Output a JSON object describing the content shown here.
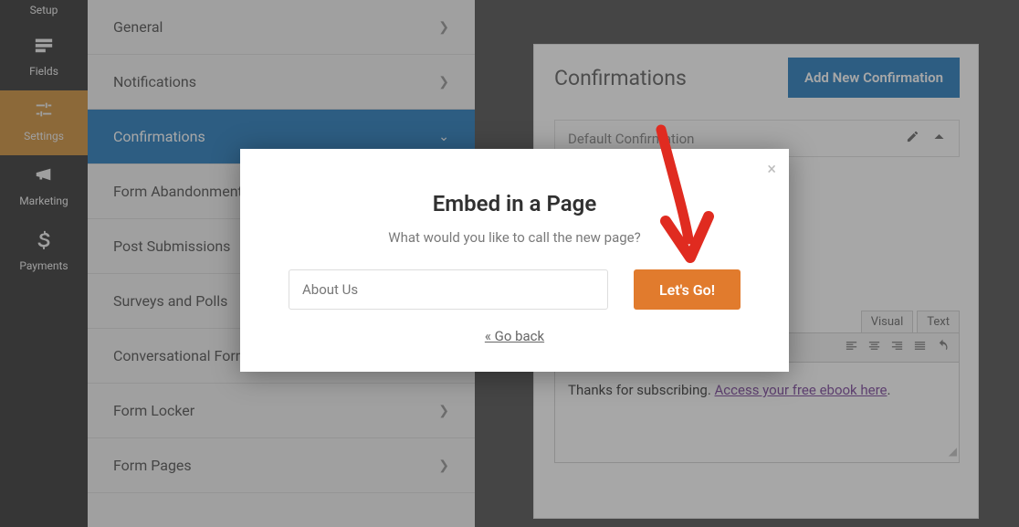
{
  "sidebar": {
    "items": [
      {
        "label": "Setup"
      },
      {
        "label": "Fields"
      },
      {
        "label": "Settings"
      },
      {
        "label": "Marketing"
      },
      {
        "label": "Payments"
      }
    ]
  },
  "settings_panel": {
    "items": [
      {
        "label": "General"
      },
      {
        "label": "Notifications"
      },
      {
        "label": "Confirmations"
      },
      {
        "label": "Form Abandonment"
      },
      {
        "label": "Post Submissions"
      },
      {
        "label": "Surveys and Polls"
      },
      {
        "label": "Conversational Forms"
      },
      {
        "label": "Form Locker"
      },
      {
        "label": "Form Pages"
      }
    ]
  },
  "main": {
    "title": "Confirmations",
    "add_btn": "Add New Confirmation",
    "default_row": "Default Confirmation",
    "editor": {
      "tab_visual": "Visual",
      "tab_text": "Text",
      "content_prefix": "Thanks for subscribing. ",
      "content_link": "Access your free ebook here",
      "content_suffix": "."
    }
  },
  "modal": {
    "title": "Embed in a Page",
    "subtitle": "What would you like to call the new page?",
    "input_value": "About Us",
    "go_btn": "Let's Go!",
    "back_link": "« Go back"
  }
}
